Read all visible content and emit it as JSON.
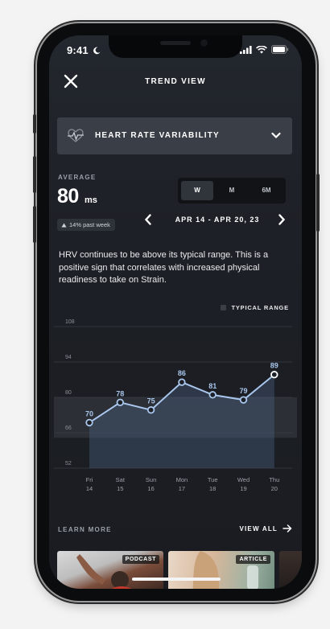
{
  "status_bar": {
    "time": "9:41"
  },
  "header": {
    "title": "TREND VIEW"
  },
  "metric_selector": {
    "label": "HEART RATE VARIABILITY"
  },
  "average": {
    "label": "AVERAGE",
    "value": "80",
    "unit": "ms",
    "change_text": "14% past week"
  },
  "range_tabs": [
    {
      "label": "W",
      "active": true
    },
    {
      "label": "M",
      "active": false
    },
    {
      "label": "6M",
      "active": false
    }
  ],
  "date_range": "APR 14 - APR 20, 23",
  "insight_text": "HRV continues to be above its typical range. This is a positive sign that correlates with increased physical readiness to take on Strain.",
  "chart_data": {
    "type": "line",
    "legend": [
      "TYPICAL RANGE"
    ],
    "y_ticks": [
      108,
      94,
      80,
      66,
      52
    ],
    "ylim": [
      52,
      108
    ],
    "typical_range": [
      64,
      80
    ],
    "categories": [
      {
        "day": "Fri",
        "date": "14"
      },
      {
        "day": "Sat",
        "date": "15"
      },
      {
        "day": "Sun",
        "date": "16"
      },
      {
        "day": "Mon",
        "date": "17"
      },
      {
        "day": "Tue",
        "date": "18"
      },
      {
        "day": "Wed",
        "date": "19"
      },
      {
        "day": "Thu",
        "date": "20"
      }
    ],
    "values": [
      70,
      78,
      75,
      86,
      81,
      79,
      89
    ],
    "line_color": "#a9c6ec",
    "highlight_color": "#ffffff"
  },
  "learn_more": {
    "label": "LEARN MORE",
    "view_all": "VIEW ALL",
    "cards": [
      {
        "tag": "PODCAST"
      },
      {
        "tag": "ARTICLE"
      }
    ]
  },
  "colors": {
    "background": "#1d2026",
    "selector_bg": "#3a3f47",
    "accent_line": "#a9c6ec"
  }
}
